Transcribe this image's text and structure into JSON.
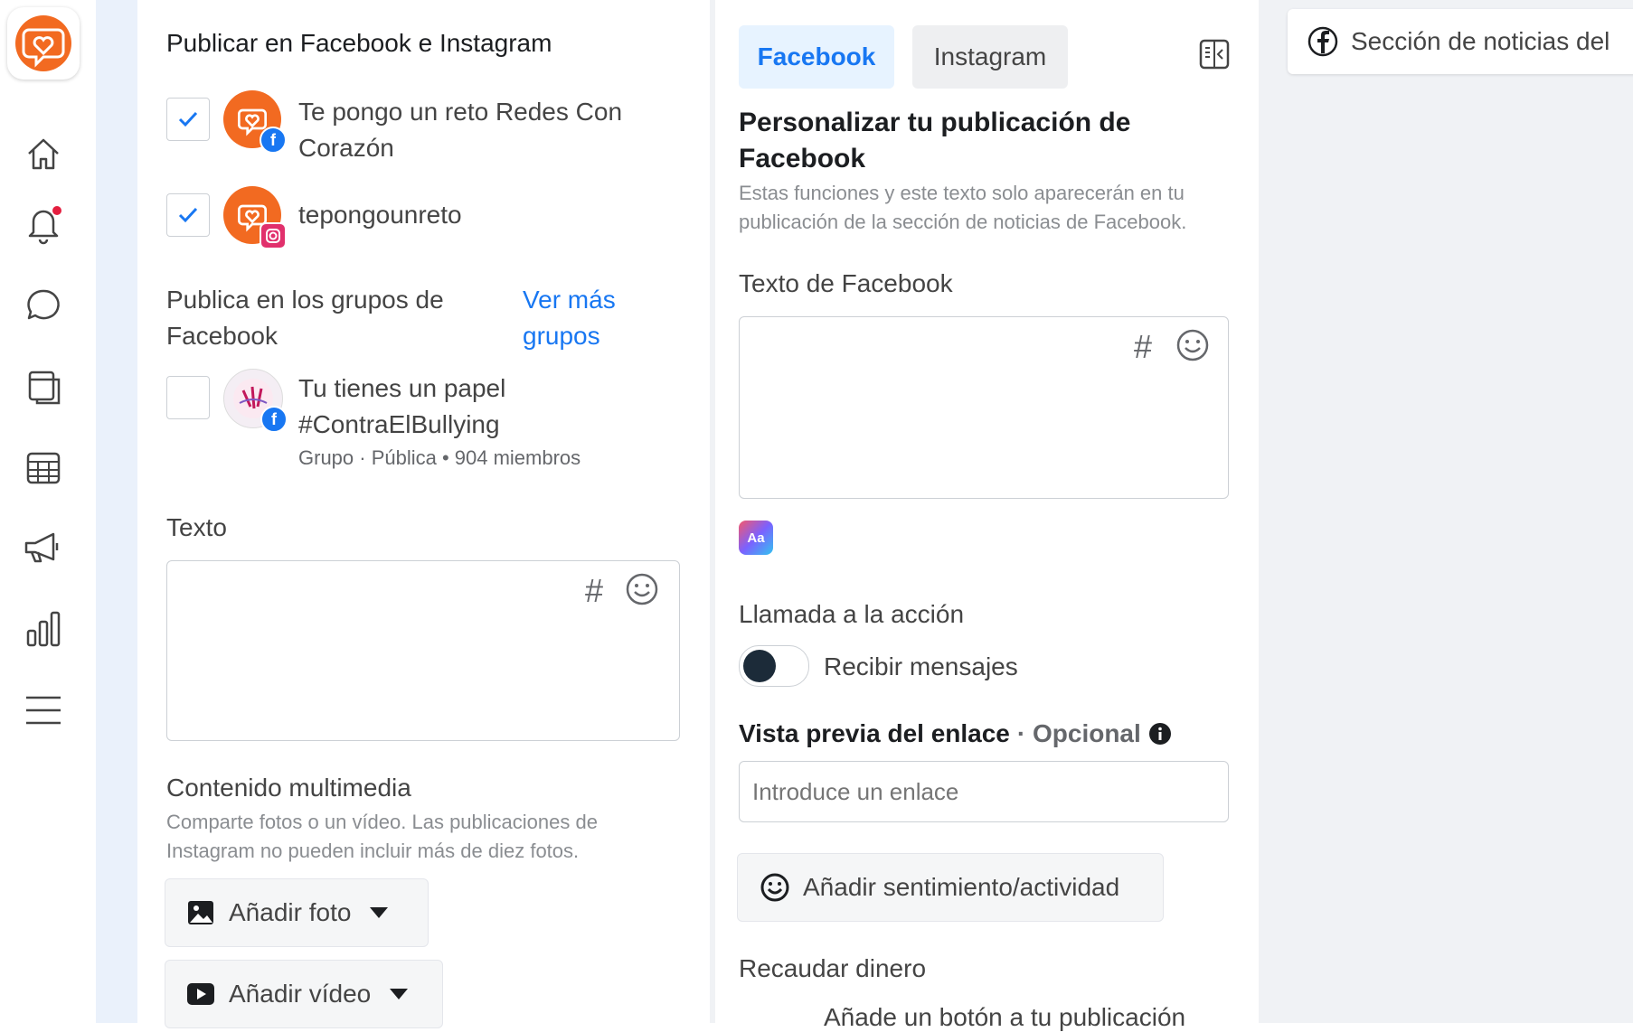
{
  "nav": {
    "items": [
      "home-icon",
      "bell-icon",
      "chat-icon",
      "pages-icon",
      "calendar-icon",
      "megaphone-icon",
      "insights-icon",
      "menu-icon"
    ]
  },
  "publish": {
    "title": "Publicar en Facebook e Instagram",
    "accounts": [
      {
        "line1": "Te pongo un reto Redes Con",
        "line2": "Corazón",
        "checked": true,
        "network": "facebook"
      },
      {
        "line1": "tepongounreto",
        "line2": "",
        "checked": true,
        "network": "instagram"
      }
    ],
    "groups_title_1": "Publica en los grupos de",
    "groups_title_2": "Facebook",
    "see_more_1": "Ver más",
    "see_more_2": "grupos",
    "group": {
      "line1": "Tu tienes un papel",
      "line2": "#ContraElBullying",
      "meta": "Grupo · Pública • 904 miembros",
      "checked": false
    },
    "text_label": "Texto",
    "media_title": "Contenido multimedia",
    "media_desc_1": "Comparte fotos o un vídeo. Las publicaciones de",
    "media_desc_2": "Instagram no pueden incluir más de diez fotos.",
    "add_photo": "Añadir foto",
    "add_video": "Añadir vídeo"
  },
  "customize": {
    "tab_facebook": "Facebook",
    "tab_instagram": "Instagram",
    "title_1": "Personalizar tu publicación de",
    "title_2": "Facebook",
    "desc_1": "Estas funciones y este texto solo aparecerán en tu",
    "desc_2": "publicación de la sección de noticias de Facebook.",
    "fb_text_label": "Texto de Facebook",
    "cta_label": "Llamada a la acción",
    "cta_toggle": "Recibir mensajes",
    "link_label": "Vista previa del enlace",
    "link_optional": "· Opcional",
    "link_placeholder": "Introduce un enlace",
    "feeling": "Añadir sentimiento/actividad",
    "fundraise": "Recaudar dinero",
    "fundraise_desc": "Añade un botón a tu publicación"
  },
  "preview": {
    "feed_label": "Sección de noticias del"
  },
  "colors": {
    "accent": "#1877f2",
    "brand": "#f26a21",
    "tab_active_bg": "#e7f3ff"
  }
}
